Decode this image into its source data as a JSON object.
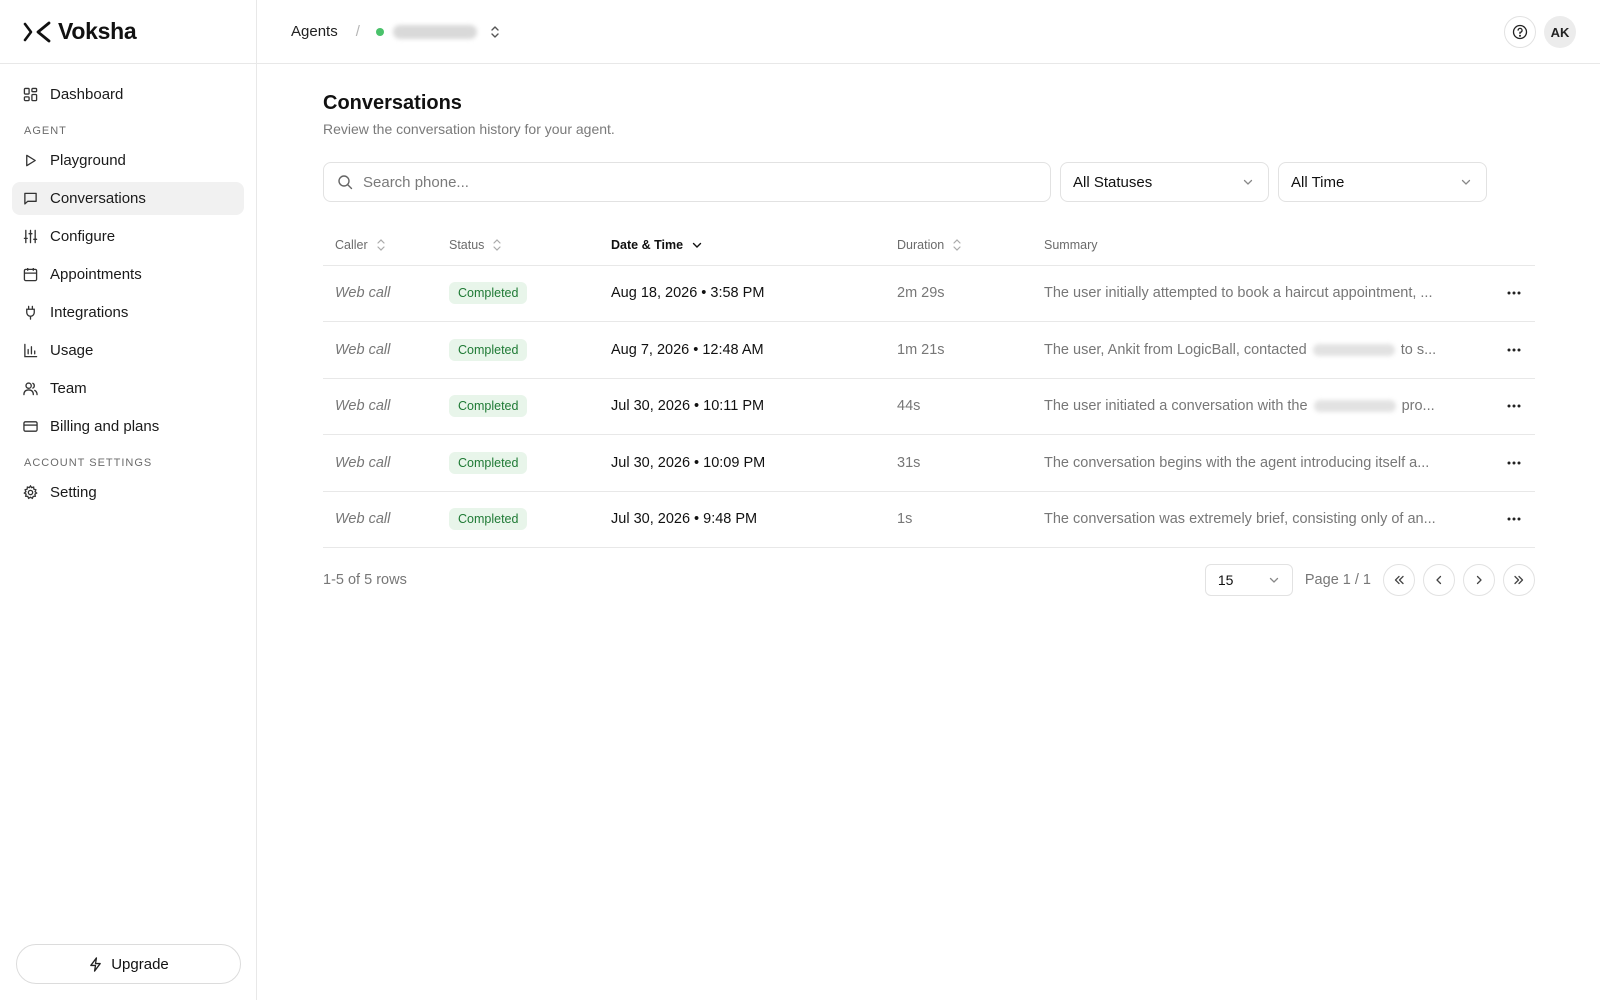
{
  "app": {
    "name": "Voksha"
  },
  "sidebar": {
    "dashboard_label": "Dashboard",
    "agent_section": "AGENT",
    "items": [
      {
        "label": "Playground",
        "icon": "play-icon"
      },
      {
        "label": "Conversations",
        "icon": "message-icon",
        "active": true
      },
      {
        "label": "Configure",
        "icon": "sliders-icon"
      },
      {
        "label": "Appointments",
        "icon": "calendar-icon"
      },
      {
        "label": "Integrations",
        "icon": "plug-icon"
      },
      {
        "label": "Usage",
        "icon": "bar-chart-icon"
      },
      {
        "label": "Team",
        "icon": "users-icon"
      },
      {
        "label": "Billing and plans",
        "icon": "credit-card-icon"
      }
    ],
    "account_section": "ACCOUNT SETTINGS",
    "setting_label": "Setting",
    "upgrade_label": "Upgrade"
  },
  "topbar": {
    "breadcrumb_root": "Agents",
    "breadcrumb_sep": "/",
    "avatar_initials": "AK"
  },
  "page": {
    "title": "Conversations",
    "subtitle": "Review the conversation history for your agent."
  },
  "filters": {
    "search_placeholder": "Search phone...",
    "status_value": "All Statuses",
    "time_value": "All Time"
  },
  "table": {
    "headers": {
      "caller": "Caller",
      "status": "Status",
      "datetime": "Date & Time",
      "duration": "Duration",
      "summary": "Summary"
    },
    "rows": [
      {
        "caller": "Web call",
        "status": "Completed",
        "datetime": "Aug 18, 2026 • 3:58 PM",
        "duration": "2m 29s",
        "summary_a": "The user initially attempted to book a haircut appointment, ...",
        "summary_b": ""
      },
      {
        "caller": "Web call",
        "status": "Completed",
        "datetime": "Aug 7, 2026 • 12:48 AM",
        "duration": "1m 21s",
        "summary_a": "The user, Ankit from LogicBall, contacted",
        "summary_b": "to s..."
      },
      {
        "caller": "Web call",
        "status": "Completed",
        "datetime": "Jul 30, 2026 • 10:11 PM",
        "duration": "44s",
        "summary_a": "The user initiated a conversation with the",
        "summary_b": "pro..."
      },
      {
        "caller": "Web call",
        "status": "Completed",
        "datetime": "Jul 30, 2026 • 10:09 PM",
        "duration": "31s",
        "summary_a": "The conversation begins with the agent introducing itself a...",
        "summary_b": ""
      },
      {
        "caller": "Web call",
        "status": "Completed",
        "datetime": "Jul 30, 2026 • 9:48 PM",
        "duration": "1s",
        "summary_a": "The conversation was extremely brief, consisting only of an...",
        "summary_b": ""
      }
    ]
  },
  "footer": {
    "row_count": "1-5 of 5 rows",
    "page_size": "15",
    "page_label": "Page 1 / 1"
  },
  "colors": {
    "accent_green": "#4ac26b",
    "badge_bg": "#e8f5ea",
    "badge_text": "#1f7a35",
    "active_nav_bg": "#f1f1f1"
  }
}
